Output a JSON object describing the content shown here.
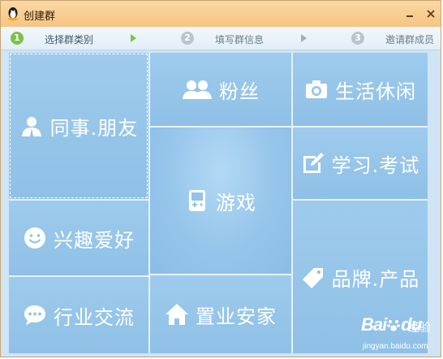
{
  "window": {
    "title": "创建群"
  },
  "colors": {
    "accent_step": "#7cc24a",
    "inactive_step": "#b9c4cc",
    "tile": "#93c3e8",
    "titlebar": "#f8cf95"
  },
  "steps": [
    {
      "number": "1",
      "label": "选择群类别",
      "state": "active"
    },
    {
      "number": "2",
      "label": "填写群信息",
      "state": "inactive"
    },
    {
      "number": "3",
      "label": "邀请群成员",
      "state": "inactive"
    }
  ],
  "categories": {
    "coworkers": {
      "label": "同事.朋友",
      "icon": "person-icon"
    },
    "fans": {
      "label": "粉丝",
      "icon": "users-icon"
    },
    "leisure": {
      "label": "生活休闲",
      "icon": "camera-icon"
    },
    "games": {
      "label": "游戏",
      "icon": "gamepad-icon"
    },
    "study": {
      "label": "学习.考试",
      "icon": "edit-icon"
    },
    "hobbies": {
      "label": "兴趣爱好",
      "icon": "smiley-icon"
    },
    "brand": {
      "label": "品牌.产品",
      "icon": "tag-icon"
    },
    "industry": {
      "label": "行业交流",
      "icon": "chat-icon"
    },
    "realestate": {
      "label": "置业安家",
      "icon": "house-icon"
    }
  },
  "watermark": {
    "brand": "Bai",
    "brand_tail": "du",
    "cn": "经验",
    "url": "jingyan.baidu.com"
  }
}
